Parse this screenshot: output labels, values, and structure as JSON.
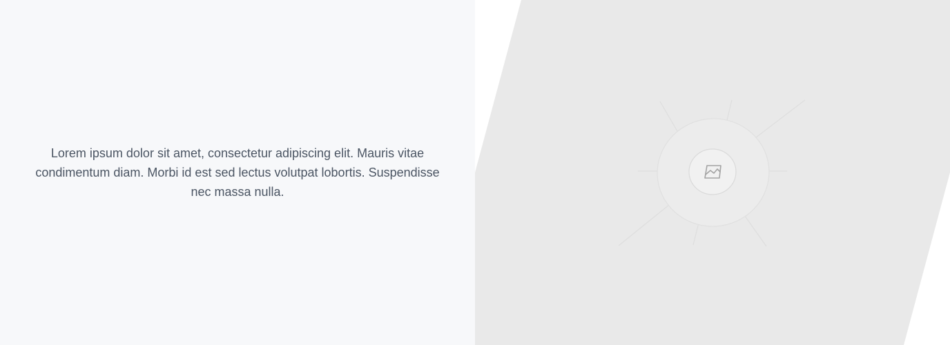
{
  "hero": {
    "body_text": "Lorem ipsum dolor sit amet, consectetur adipiscing elit. Mauris vitae condimentum diam. Morbi id est sed lectus volutpat lobortis. Suspendisse nec massa nulla."
  },
  "image_placeholder": {
    "icon": "image-icon",
    "background_color": "#e9e9e9",
    "panel_color": "#f7f8fa"
  }
}
